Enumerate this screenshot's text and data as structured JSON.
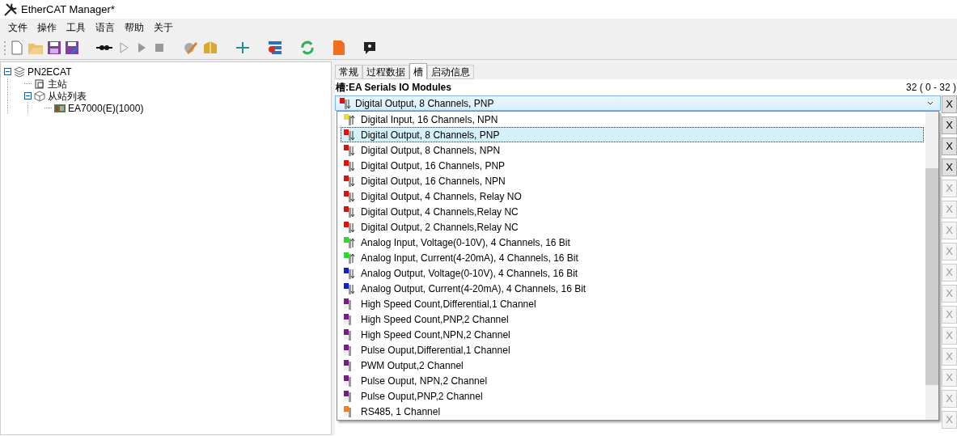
{
  "window": {
    "title": "EtherCAT Manager*"
  },
  "menu": [
    "文件",
    "操作",
    "工具",
    "语言",
    "帮助",
    "关于"
  ],
  "tree": [
    {
      "label": "PN2ECAT",
      "kind": "root",
      "expanded": true,
      "children": [
        {
          "label": "主站",
          "kind": "master"
        },
        {
          "label": "从站列表",
          "kind": "slaves",
          "expanded": true,
          "children": [
            {
              "label": "EA7000(E)(1000)",
              "kind": "device"
            }
          ]
        }
      ]
    }
  ],
  "tabs": [
    {
      "label": "常规",
      "selected": false
    },
    {
      "label": "过程数据",
      "selected": false
    },
    {
      "label": "槽",
      "selected": true
    },
    {
      "label": "启动信息",
      "selected": false
    }
  ],
  "slot_header": {
    "title": "槽:EA Serials IO Modules",
    "count": "32 ( 0 - 32 )"
  },
  "combo": {
    "value": "Digital Output, 8 Channels, PNP",
    "color": "#e01010",
    "kind": "down"
  },
  "dropdown": [
    {
      "label": "Digital Input, 16 Channels, NPN",
      "color": "#e8e020",
      "kind": "up",
      "selected": false
    },
    {
      "label": "Digital Output, 8 Channels, PNP",
      "color": "#e01010",
      "kind": "down",
      "selected": true
    },
    {
      "label": "Digital Output, 8 Channels, NPN",
      "color": "#e01010",
      "kind": "down",
      "selected": false
    },
    {
      "label": "Digital Output, 16 Channels, PNP",
      "color": "#e01010",
      "kind": "down",
      "selected": false
    },
    {
      "label": "Digital Output, 16 Channels, NPN",
      "color": "#e01010",
      "kind": "down",
      "selected": false
    },
    {
      "label": "Digital Output, 4 Channels, Relay NO",
      "color": "#e01010",
      "kind": "down",
      "selected": false
    },
    {
      "label": "Digital Output, 4 Channels,Relay NC",
      "color": "#e01010",
      "kind": "down",
      "selected": false
    },
    {
      "label": "Digital Output, 2 Channels,Relay NC",
      "color": "#e01010",
      "kind": "down",
      "selected": false
    },
    {
      "label": "Analog Input, Voltage(0-10V), 4 Channels, 16 Bit",
      "color": "#20e020",
      "kind": "up",
      "selected": false
    },
    {
      "label": "Analog Input, Current(4-20mA), 4 Channels, 16 Bit",
      "color": "#20e020",
      "kind": "up",
      "selected": false
    },
    {
      "label": "Analog Output, Voltage(0-10V), 4 Channels, 16 Bit",
      "color": "#1020d0",
      "kind": "down",
      "selected": false
    },
    {
      "label": "Analog Output, Current(4-20mA), 4 Channels, 16 Bit",
      "color": "#1020d0",
      "kind": "down",
      "selected": false
    },
    {
      "label": "High Speed Count,Differential,1 Channel",
      "color": "#7a1a8a",
      "kind": "special",
      "selected": false
    },
    {
      "label": "High Speed Count,PNP,2 Channel",
      "color": "#7a1a8a",
      "kind": "special",
      "selected": false
    },
    {
      "label": "High Speed Count,NPN,2 Channel",
      "color": "#7a1a8a",
      "kind": "special",
      "selected": false
    },
    {
      "label": "Pulse Ouput,Differential,1 Channel",
      "color": "#7a1a8a",
      "kind": "special",
      "selected": false
    },
    {
      "label": "PWM Output,2 Channel",
      "color": "#7a1a8a",
      "kind": "special",
      "selected": false
    },
    {
      "label": "Pulse Ouput, NPN,2 Channel",
      "color": "#7a1a8a",
      "kind": "special",
      "selected": false
    },
    {
      "label": "Pulse Ouput,PNP,2 Channel",
      "color": "#7a1a8a",
      "kind": "special",
      "selected": false
    },
    {
      "label": "RS485, 1 Channel",
      "color": "#f08020",
      "kind": "special",
      "selected": false
    }
  ],
  "remove_buttons": [
    {
      "label": "X",
      "disabled": false
    },
    {
      "label": "X",
      "disabled": false
    },
    {
      "label": "X",
      "disabled": false
    },
    {
      "label": "X",
      "disabled": false
    },
    {
      "label": "X",
      "disabled": true
    },
    {
      "label": "X",
      "disabled": true
    },
    {
      "label": "X",
      "disabled": true
    },
    {
      "label": "X",
      "disabled": true
    },
    {
      "label": "X",
      "disabled": true
    },
    {
      "label": "X",
      "disabled": true
    },
    {
      "label": "X",
      "disabled": true
    },
    {
      "label": "X",
      "disabled": true
    },
    {
      "label": "X",
      "disabled": true
    },
    {
      "label": "X",
      "disabled": true
    },
    {
      "label": "X",
      "disabled": true
    },
    {
      "label": "X",
      "disabled": true
    }
  ]
}
